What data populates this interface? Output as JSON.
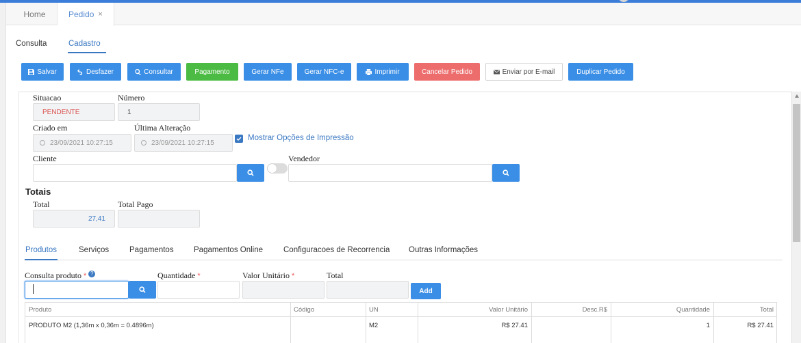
{
  "top_tabs": [
    {
      "label": "Home"
    },
    {
      "label": "Pedido",
      "close": "×"
    }
  ],
  "sub_tabs": [
    {
      "label": "Consulta"
    },
    {
      "label": "Cadastro",
      "active": true
    }
  ],
  "toolbar": {
    "salvar": "Salvar",
    "desfazer": "Desfazer",
    "consultar": "Consultar",
    "pagamento": "Pagamento",
    "gerar_nfe": "Gerar NFe",
    "gerar_nfce": "Gerar NFC-e",
    "imprimir": "Imprimir",
    "cancelar": "Cancelar Pedido",
    "enviar_email": "Enviar por E-mail",
    "duplicar": "Duplicar Pedido"
  },
  "form": {
    "situacao_label": "Situacao",
    "situacao_value": "PENDENTE",
    "numero_label": "Número",
    "numero_value": "1",
    "criado_label": "Criado em",
    "criado_value": "23/09/2021 10:27:15",
    "alteracao_label": "Última Alteração",
    "alteracao_value": "23/09/2021 10:27:15",
    "mostrar_opcoes": "Mostrar Opções de Impressão",
    "mostrar_opcoes_checked": true,
    "cliente_label": "Cliente",
    "cliente_value": "",
    "vendedor_label": "Vendedor",
    "vendedor_value": ""
  },
  "totais": {
    "title": "Totais",
    "total_label": "Total",
    "total_value": "27,41",
    "total_pago_label": "Total Pago",
    "total_pago_value": ""
  },
  "product_tabs": [
    {
      "label": "Produtos",
      "active": true
    },
    {
      "label": "Serviços"
    },
    {
      "label": "Pagamentos"
    },
    {
      "label": "Pagamentos Online"
    },
    {
      "label": "Configuracoes de Recorrencia"
    },
    {
      "label": "Outras Informações"
    }
  ],
  "add_product": {
    "consulta_label": "Consulta produto",
    "required_mark": "*",
    "help_icon": "?",
    "quantidade_label": "Quantidade",
    "valor_label": "Valor Unitário",
    "total_label": "Total",
    "add_button": "Add"
  },
  "table": {
    "columns": [
      "Produto",
      "Código",
      "UN",
      "Valor Unitário",
      "Desc.R$",
      "Quantidade",
      "Total"
    ],
    "rows": [
      [
        "PRODUTO M2 (1,36m x 0,36m = 0.4896m)",
        "",
        "M2",
        "R$ 27.41",
        "",
        "1",
        "R$ 27.41"
      ]
    ]
  },
  "colors": {
    "primary": "#3a8ee6",
    "success": "#4cbb43",
    "danger": "#ed6d6d",
    "accent_text": "#3a78c2",
    "status_text": "#d9534f"
  },
  "icons": [
    "save-icon",
    "undo-icon",
    "search-icon",
    "print-icon",
    "envelope-icon",
    "check-icon",
    "clock-icon",
    "help-icon",
    "close-icon"
  ]
}
